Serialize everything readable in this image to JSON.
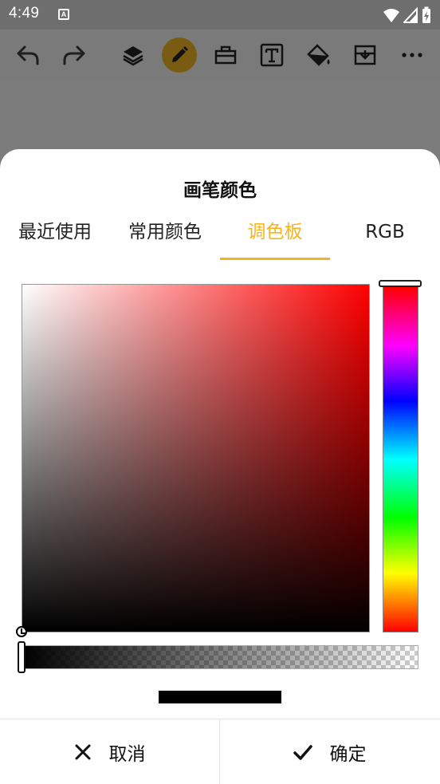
{
  "status_bar": {
    "time": "4:49",
    "notification_icon": "A"
  },
  "toolbar": {
    "icons": [
      "undo-icon",
      "redo-icon",
      "layers-icon",
      "pencil-icon",
      "toolbox-icon",
      "text-icon",
      "fill-bucket-icon",
      "save-icon",
      "more-icon"
    ],
    "active_tool": "pencil",
    "active_color": "#7a5b12"
  },
  "dialog": {
    "title": "画笔颜色",
    "tabs": [
      "最近使用",
      "常用颜色",
      "调色板",
      "RGB"
    ],
    "active_tab": "调色板",
    "accent_color": "#f5b41e",
    "picker": {
      "hue": "red",
      "saturation": 0,
      "value": 0,
      "alpha": 1,
      "selected_color": "#000000"
    },
    "cancel_label": "取消",
    "confirm_label": "确定"
  }
}
